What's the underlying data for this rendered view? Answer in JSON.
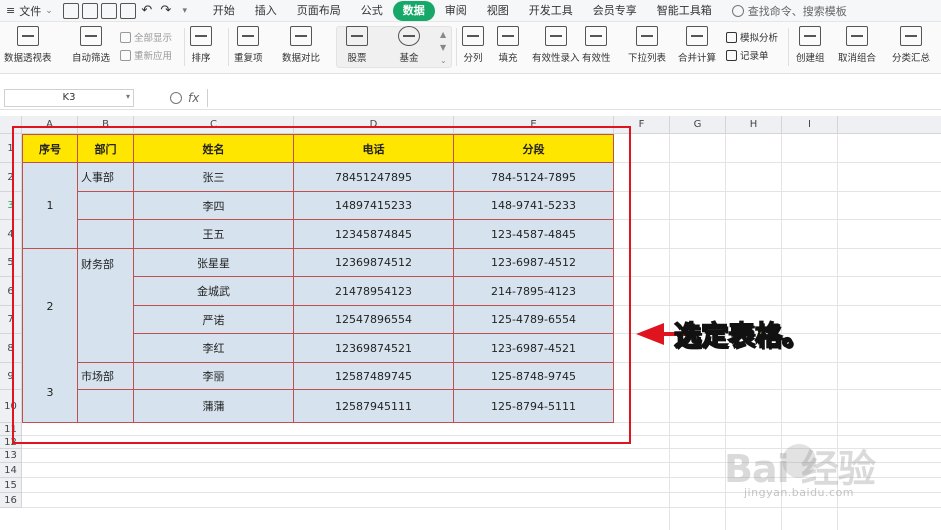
{
  "menubar": {
    "file_label": "文件",
    "tabs": [
      {
        "label": "开始",
        "active": false
      },
      {
        "label": "插入",
        "active": false
      },
      {
        "label": "页面布局",
        "active": false
      },
      {
        "label": "公式",
        "active": false
      },
      {
        "label": "数据",
        "active": true
      },
      {
        "label": "审阅",
        "active": false
      },
      {
        "label": "视图",
        "active": false
      },
      {
        "label": "开发工具",
        "active": false
      },
      {
        "label": "会员专享",
        "active": false
      },
      {
        "label": "智能工具箱",
        "active": false
      }
    ],
    "search_label": "查找命令、搜索模板"
  },
  "ribbon": {
    "pivot": "数据透视表",
    "autofilter": "自动筛选",
    "show_all": "全部显示",
    "reapply": "重新应用",
    "sort": "排序",
    "duplicates": "重复项",
    "compare": "数据对比",
    "stock": "股票",
    "fund": "基金",
    "split": "分列",
    "fill": "填充",
    "validation_entry": "有效性录入",
    "validity": "有效性",
    "dropdown": "下拉列表",
    "consolidate": "合并计算",
    "simulation": "模拟分析",
    "record": "记录单",
    "group": "创建组",
    "ungroup": "取消组合",
    "subtotal": "分类汇总"
  },
  "formula_bar": {
    "cell_ref": "K3",
    "fx": "fx"
  },
  "columns": [
    "A",
    "B",
    "C",
    "D",
    "E",
    "F",
    "G",
    "H",
    "I"
  ],
  "rows": [
    "1",
    "2",
    "3",
    "4",
    "5",
    "6",
    "7",
    "8",
    "9",
    "10",
    "11",
    "12",
    "13",
    "14",
    "15",
    "16"
  ],
  "selected_row": "3",
  "table": {
    "headers": [
      "序号",
      "部门",
      "姓名",
      "电话",
      "分段"
    ],
    "groups": [
      {
        "seq": "1",
        "dept": "人事部"
      },
      {
        "seq": "2",
        "dept": "财务部"
      },
      {
        "seq": "3",
        "dept": "市场部"
      }
    ],
    "rows": [
      {
        "name": "张三",
        "phone": "78451247895",
        "seg": "784-5124-7895"
      },
      {
        "name": "李四",
        "phone": "14897415233",
        "seg": "148-9741-5233"
      },
      {
        "name": "王五",
        "phone": "12345874845",
        "seg": "123-4587-4845"
      },
      {
        "name": "张星星",
        "phone": "12369874512",
        "seg": "123-6987-4512"
      },
      {
        "name": "金城武",
        "phone": "21478954123",
        "seg": "214-7895-4123"
      },
      {
        "name": "严诺",
        "phone": "12547896554",
        "seg": "125-4789-6554"
      },
      {
        "name": "李红",
        "phone": "12369874521",
        "seg": "123-6987-4521"
      },
      {
        "name": "李丽",
        "phone": "12587489745",
        "seg": "125-8748-9745"
      },
      {
        "name": "蒲蒲",
        "phone": "12587945111",
        "seg": "125-8794-5111"
      }
    ]
  },
  "annotation": "选定表格。",
  "watermark": {
    "logo": "Bai  经验",
    "sub": "jingyan.baidu.com"
  },
  "colors": {
    "accent": "#16a868",
    "header_fill": "#ffe600",
    "body_fill": "#d6e3ee",
    "border": "#c0504d",
    "highlight": "#e0141e"
  }
}
